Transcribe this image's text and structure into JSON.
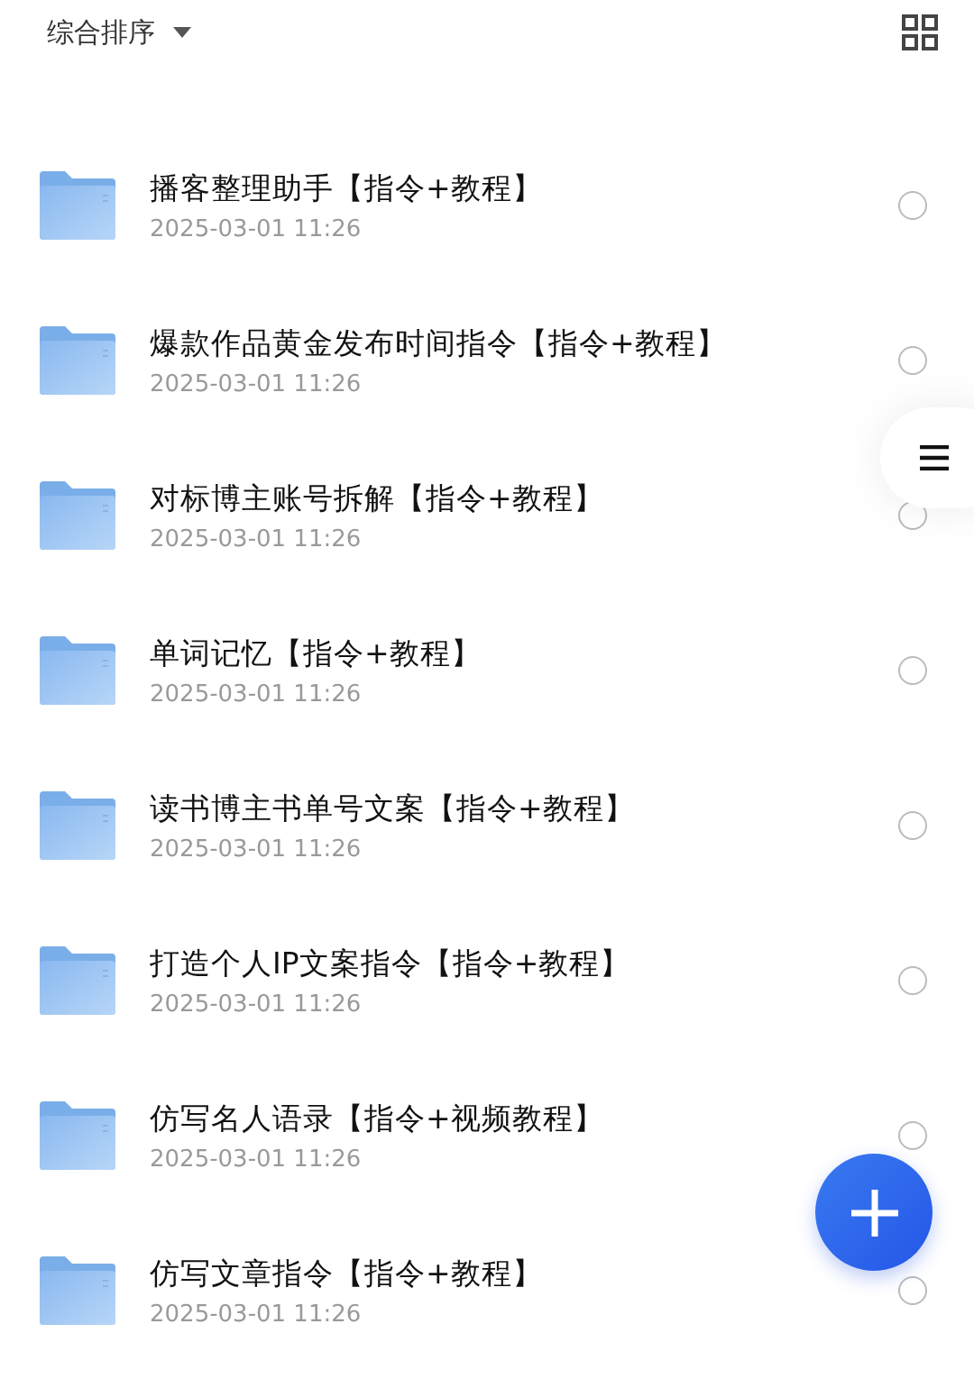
{
  "toolbar": {
    "sort_label": "综合排序"
  },
  "files": [
    {
      "name": "播客整理助手【指令+教程】",
      "date": "2025-03-01 11:26",
      "selected": false
    },
    {
      "name": "爆款作品黄金发布时间指令【指令+教程】",
      "date": "2025-03-01 11:26",
      "selected": false
    },
    {
      "name": "对标博主账号拆解【指令+教程】",
      "date": "2025-03-01 11:26",
      "selected": false
    },
    {
      "name": "单词记忆【指令+教程】",
      "date": "2025-03-01 11:26",
      "selected": false
    },
    {
      "name": "读书博主书单号文案【指令+教程】",
      "date": "2025-03-01 11:26",
      "selected": false
    },
    {
      "name": "打造个人IP文案指令【指令+教程】",
      "date": "2025-03-01 11:26",
      "selected": false
    },
    {
      "name": "仿写名人语录【指令+视频教程】",
      "date": "2025-03-01 11:26",
      "selected": false
    },
    {
      "name": "仿写文章指令【指令+教程】",
      "date": "2025-03-01 11:26",
      "selected": false
    }
  ]
}
